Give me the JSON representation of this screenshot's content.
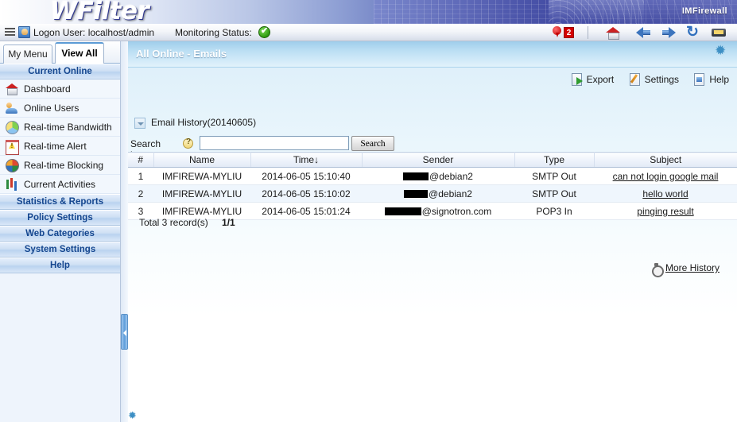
{
  "banner": {
    "logo": "WFilter",
    "brand": "IMFirewall"
  },
  "statusbar": {
    "menu_icon": "hamburger-icon",
    "user_icon": "user-icon",
    "logon_user": "Logon User: localhost/admin",
    "monitoring_label": "Monitoring Status:",
    "monitoring_state_icon": "green-check-icon",
    "alert_pin_icon": "map-pin-icon",
    "alert_count": "2",
    "tools": [
      {
        "name": "home-icon",
        "label": "Home"
      },
      {
        "name": "back-arrow-icon",
        "label": "Back"
      },
      {
        "name": "forward-arrow-icon",
        "label": "Forward"
      },
      {
        "name": "refresh-icon",
        "label": "Refresh"
      },
      {
        "name": "print-icon",
        "label": "Print"
      }
    ]
  },
  "sidebar": {
    "tabs": [
      {
        "label": "My Menu",
        "active": false
      },
      {
        "label": "View All",
        "active": true
      }
    ],
    "groups": [
      {
        "label": "Current Online",
        "items": [
          {
            "label": "Dashboard",
            "icon": "house-icon"
          },
          {
            "label": "Online Users",
            "icon": "users-icon"
          },
          {
            "label": "Real-time Bandwidth",
            "icon": "pie-chart-icon"
          },
          {
            "label": "Real-time Alert",
            "icon": "calendar-alert-icon"
          },
          {
            "label": "Real-time Blocking",
            "icon": "block-ball-icon"
          },
          {
            "label": "Current Activities",
            "icon": "bar-chart-icon"
          }
        ]
      },
      {
        "label": "Statistics & Reports",
        "items": []
      },
      {
        "label": "Policy Settings",
        "items": []
      },
      {
        "label": "Web Categories",
        "items": []
      },
      {
        "label": "System Settings",
        "items": []
      },
      {
        "label": "Help",
        "items": []
      }
    ]
  },
  "panel": {
    "title": "All Online - Emails",
    "pin_icon": "pin-panel-icon",
    "actions": [
      {
        "label": "Export",
        "icon": "export-icon"
      },
      {
        "label": "Settings",
        "icon": "settings-icon"
      },
      {
        "label": "Help",
        "icon": "help-icon"
      }
    ],
    "history_label": "Email History(20140605)",
    "search": {
      "label": "Search by:",
      "help_icon": "question-mark-icon",
      "value": "",
      "placeholder": "",
      "button_label": "Search"
    },
    "table": {
      "columns": [
        "#",
        "Name",
        "Time↓",
        "Sender",
        "Type",
        "Subject"
      ],
      "rows": [
        {
          "num": "1",
          "name": "IMFIREWA-MYLIU",
          "time": "2014-06-05 15:10:40",
          "sender_redacted_width": 32,
          "sender_domain": "@debian2",
          "type": "SMTP Out",
          "subject": "can not login google mail"
        },
        {
          "num": "2",
          "name": "IMFIREWA-MYLIU",
          "time": "2014-06-05 15:10:02",
          "sender_redacted_width": 30,
          "sender_domain": "@debian2",
          "type": "SMTP Out",
          "subject": "hello world"
        },
        {
          "num": "3",
          "name": "IMFIREWA-MYLIU",
          "time": "2014-06-05 15:01:24",
          "sender_redacted_width": 46,
          "sender_domain": "@signotron.com",
          "type": "POP3 In",
          "subject": "pinging result"
        }
      ]
    },
    "total_label": "Total 3 record(s)",
    "page_label": "1/1",
    "more_history_label": "More History",
    "more_history_icon": "stopwatch-icon"
  },
  "colors": {
    "banner_start": "#ffffff",
    "banner_end": "#2c3590",
    "panel_header": "#9fcdeb",
    "sidebar_bg": "#eef4fc",
    "group_text": "#14468f",
    "alert_badge": "#d30000",
    "status_ok": "#2f9c12"
  }
}
